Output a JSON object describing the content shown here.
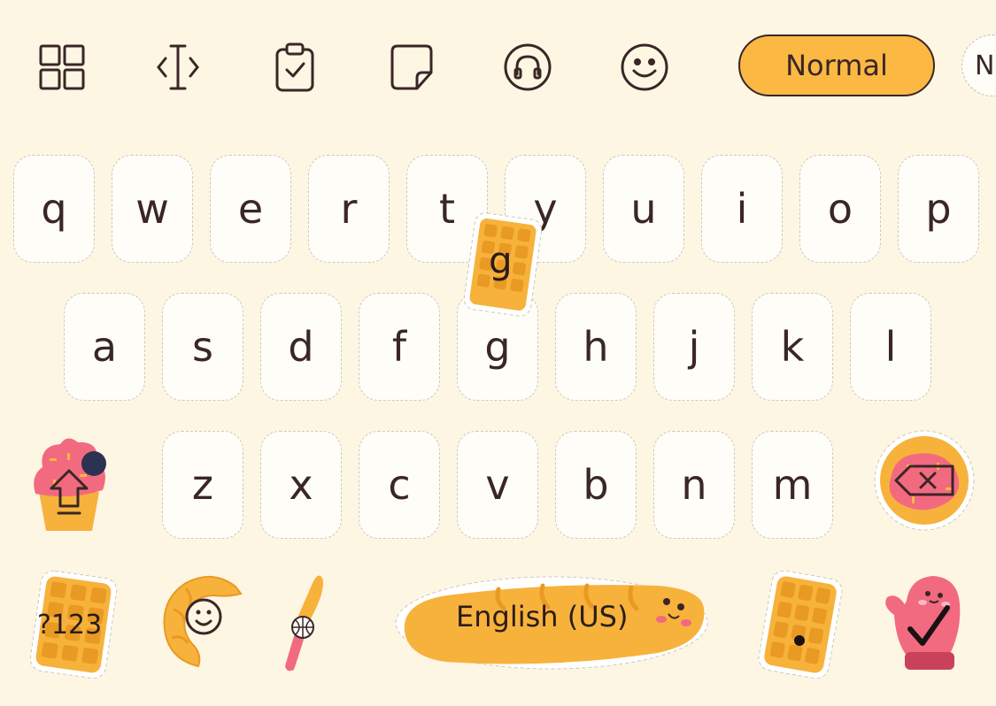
{
  "toolbar": {
    "icons": [
      "grid-icon",
      "text-cursor-icon",
      "clipboard-icon",
      "sticky-note-icon",
      "headphones-icon",
      "smiley-icon"
    ],
    "mode_label": "Normal",
    "next_mode_label": "N"
  },
  "keyboard": {
    "row1": [
      "q",
      "w",
      "e",
      "r",
      "t",
      "y",
      "u",
      "i",
      "o",
      "p"
    ],
    "row2": [
      "a",
      "s",
      "d",
      "f",
      "g",
      "h",
      "j",
      "k",
      "l"
    ],
    "row3": [
      "z",
      "x",
      "c",
      "v",
      "b",
      "n",
      "m"
    ],
    "popup_key": "g",
    "symbols_label": "?123",
    "space_label": "English (US)",
    "period_label": "."
  },
  "colors": {
    "background": "#fdf6e3",
    "accent": "#fbb843",
    "text": "#3a2626",
    "pink": "#f26a80"
  }
}
